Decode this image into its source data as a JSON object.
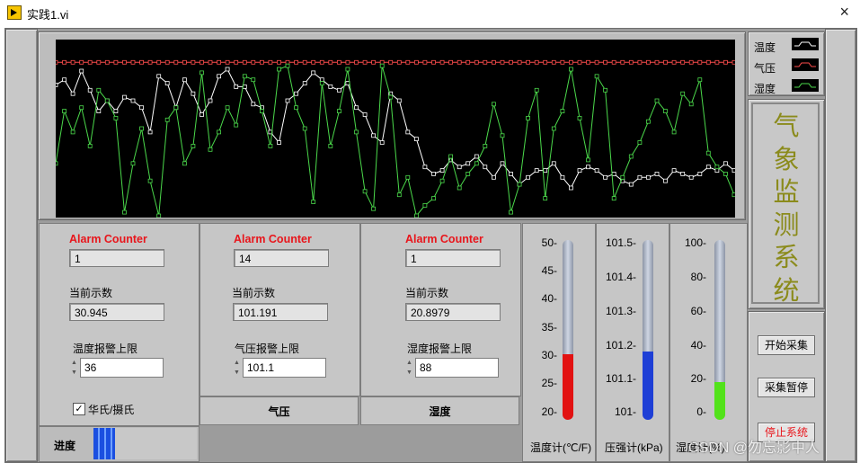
{
  "window": {
    "title": "实践1.vi",
    "close_symbol": "×"
  },
  "legend": {
    "items": [
      {
        "name": "温度",
        "color": "#ffffff"
      },
      {
        "name": "气压",
        "color": "#ff4d4d"
      },
      {
        "name": "湿度",
        "color": "#4bd94b"
      }
    ]
  },
  "system_title": [
    "气",
    "象",
    "监",
    "测",
    "系",
    "统"
  ],
  "buttons": {
    "start": "开始采集",
    "pause": "采集暂停",
    "stop": "停止系统"
  },
  "progress": {
    "label": "进度",
    "value": 0.21
  },
  "sections": {
    "temperature": {
      "counter_label": "Alarm Counter",
      "counter": "1",
      "current_label": "当前示数",
      "current": "30.945",
      "limit_label": "温度报警上限",
      "limit": "36",
      "unit_toggle_label": "华氏/摄氏",
      "unit_toggle_checked": true
    },
    "pressure": {
      "counter_label": "Alarm Counter",
      "counter": "14",
      "current_label": "当前示数",
      "current": "101.191",
      "limit_label": "气压报警上限",
      "limit": "101.1",
      "tab_label": "气压"
    },
    "humidity": {
      "counter_label": "Alarm Counter",
      "counter": "1",
      "current_label": "当前示数",
      "current": "20.8979",
      "limit_label": "湿度报警上限",
      "limit": "88",
      "tab_label": "湿度"
    }
  },
  "thermometers": {
    "temperature": {
      "caption": "温度计(℃/F)",
      "ticks": [
        "50-",
        "45-",
        "40-",
        "35-",
        "30-",
        "25-",
        "20-"
      ],
      "min": 20,
      "max": 50,
      "value": 30.945,
      "color": "#e21212"
    },
    "pressure": {
      "caption": "压强计(kPa)",
      "ticks": [
        "101.5-",
        "101.4-",
        "101.3-",
        "101.2-",
        "101.1-",
        "101-"
      ],
      "min": 101.0,
      "max": 101.5,
      "value": 101.191,
      "color": "#1e3fd6"
    },
    "humidity": {
      "caption": "湿度计(%)",
      "ticks": [
        "100-",
        "80-",
        "60-",
        "40-",
        "20-",
        "0-"
      ],
      "min": 0,
      "max": 100,
      "value": 20.8979,
      "color": "#52e21a"
    }
  },
  "watermark": "CSDN @勿忘影中人",
  "chart_data": {
    "type": "line",
    "title": "",
    "grid": false,
    "legend_position": "top-right",
    "ylim": [
      0,
      100
    ],
    "series": [
      {
        "name": "温度",
        "color": "#ffffff",
        "values": [
          75,
          78,
          70,
          83,
          72,
          60,
          66,
          60,
          68,
          66,
          62,
          48,
          80,
          76,
          62,
          78,
          70,
          58,
          66,
          80,
          84,
          74,
          74,
          64,
          62,
          48,
          42,
          66,
          70,
          76,
          82,
          78,
          74,
          72,
          76,
          62,
          58,
          46,
          42,
          70,
          66,
          48,
          44,
          28,
          24,
          26,
          32,
          28,
          30,
          34,
          28,
          22,
          30,
          24,
          18,
          22,
          26,
          26,
          30,
          22,
          16,
          26,
          28,
          26,
          22,
          24,
          20,
          18,
          22,
          22,
          24,
          20,
          26,
          24,
          22,
          24,
          28,
          26,
          30,
          26
        ]
      },
      {
        "name": "气压",
        "color": "#ff4d4d",
        "values": [
          88,
          88,
          88,
          88,
          88,
          88,
          88,
          88,
          88,
          88,
          88,
          88,
          88,
          88,
          88,
          88,
          88,
          88,
          88,
          88,
          88,
          88,
          88,
          88,
          88,
          88,
          88,
          88,
          88,
          88,
          88,
          88,
          88,
          88,
          88,
          88,
          88,
          88,
          88,
          88,
          88,
          88,
          88,
          88,
          88,
          88,
          88,
          88,
          88,
          88,
          88,
          88,
          88,
          88,
          88,
          88,
          88,
          88,
          88,
          88,
          88,
          88,
          88,
          88,
          88,
          88,
          88,
          88,
          88,
          88,
          88,
          88,
          88,
          88,
          88,
          88,
          88,
          88,
          88,
          88
        ]
      },
      {
        "name": "湿度",
        "color": "#4bd94b",
        "values": [
          30,
          60,
          48,
          62,
          40,
          72,
          66,
          56,
          2,
          30,
          50,
          20,
          0,
          55,
          62,
          30,
          40,
          82,
          38,
          48,
          62,
          52,
          80,
          78,
          60,
          40,
          84,
          86,
          62,
          50,
          8,
          76,
          40,
          60,
          84,
          48,
          14,
          4,
          86,
          68,
          12,
          22,
          0,
          6,
          10,
          20,
          34,
          16,
          24,
          30,
          40,
          64,
          46,
          2,
          18,
          56,
          72,
          10,
          50,
          60,
          84,
          56,
          32,
          80,
          72,
          10,
          22,
          34,
          42,
          54,
          66,
          60,
          48,
          70,
          64,
          78,
          36,
          28,
          24,
          12
        ]
      }
    ]
  }
}
